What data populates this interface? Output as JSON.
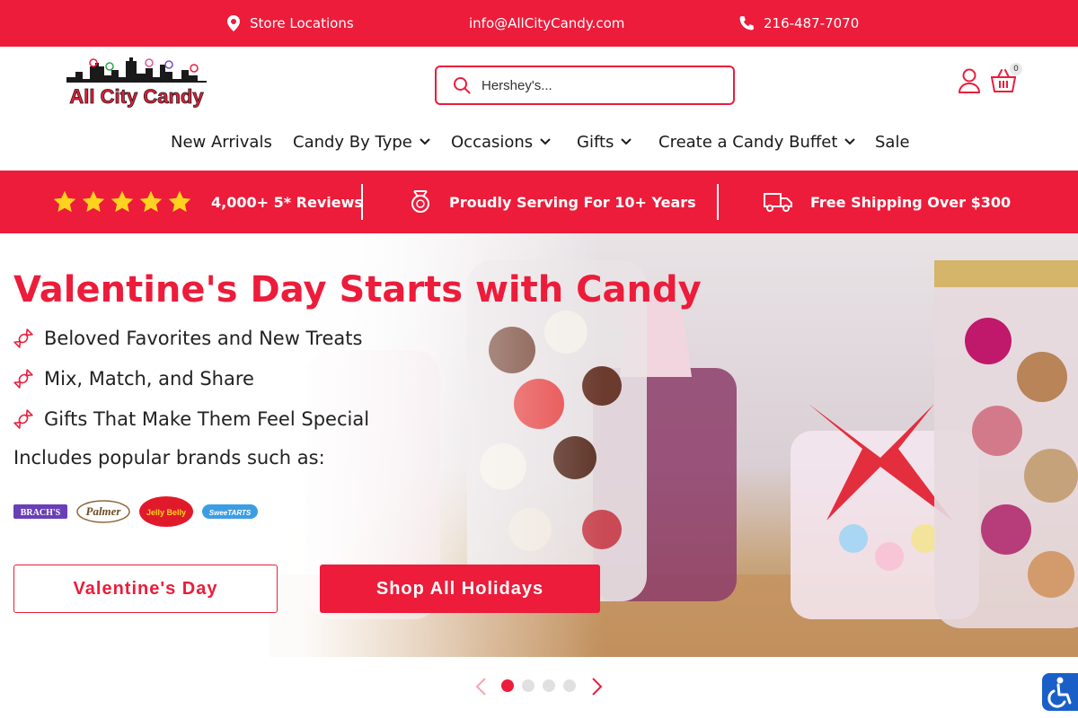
{
  "topbar": {
    "store_locations": "Store Locations",
    "email": "info@AllCityCandy.com",
    "phone": "216-487-7070"
  },
  "header": {
    "logo_text": "All City Candy",
    "search_placeholder": "Hershey's...",
    "cart_count": "0"
  },
  "nav": {
    "items": [
      {
        "label": "New Arrivals",
        "dropdown": false
      },
      {
        "label": "Candy By Type",
        "dropdown": true
      },
      {
        "label": "Occasions",
        "dropdown": true
      },
      {
        "label": "Gifts",
        "dropdown": true
      },
      {
        "label": "Create a Candy Buffet",
        "dropdown": true
      },
      {
        "label": "Sale",
        "dropdown": false
      }
    ]
  },
  "benefits": {
    "reviews": "4,000+ 5* Reviews",
    "serving": "Proudly Serving For 10+ Years",
    "shipping": "Free Shipping Over $300",
    "stars": 5
  },
  "hero": {
    "title": "Valentine's Day Starts with Candy",
    "bullets": [
      "Beloved Favorites and New Treats",
      "Mix, Match, and Share",
      "Gifts That Make Them Feel Special"
    ],
    "brands_label": "Includes popular brands such as:",
    "brands": [
      "BRACH'S",
      "Palmer",
      "Jelly Belly",
      "SweeTARTS"
    ],
    "button_primary": "Valentine's Day",
    "button_secondary": "Shop All Holidays"
  },
  "slider": {
    "slide_count": 4,
    "active_slide": 1
  },
  "colors": {
    "brand_red": "#ec1c3a",
    "accessibility_blue": "#1a5fc8"
  }
}
